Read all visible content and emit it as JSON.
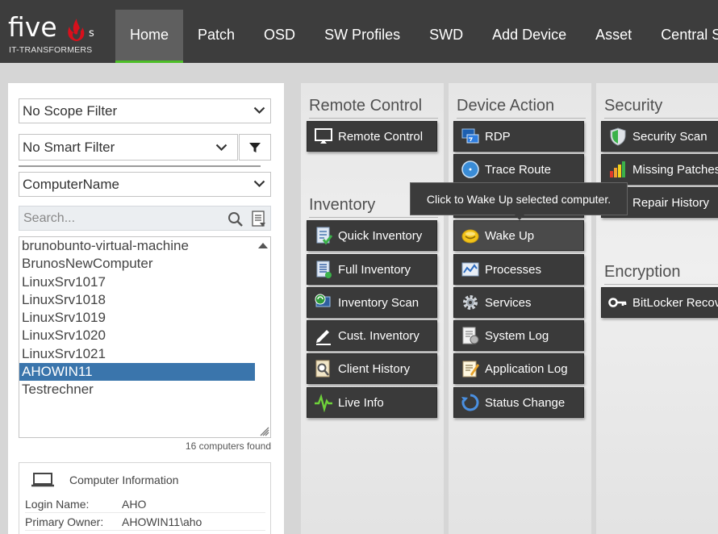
{
  "brand": {
    "word": "five",
    "suffix": "s",
    "subtitle": "IT-TRANSFORMERS"
  },
  "nav": {
    "items": [
      {
        "label": "Home",
        "active": true
      },
      {
        "label": "Patch"
      },
      {
        "label": "OSD"
      },
      {
        "label": "SW Profiles"
      },
      {
        "label": "SWD"
      },
      {
        "label": "Add Device"
      },
      {
        "label": "Asset"
      },
      {
        "label": "Central Sea"
      }
    ]
  },
  "left": {
    "scope_filter": "No Scope Filter",
    "smart_filter": "No Smart Filter",
    "attribute": "ComputerName",
    "search_placeholder": "Search...",
    "computers": [
      "brunobunto-virtual-machine",
      "BrunosNewComputer",
      "LinuxSrv1017",
      "LinuxSrv1018",
      "LinuxSrv1019",
      "LinuxSrv1020",
      "LinuxSrv1021",
      "AHOWIN11",
      "Testrechner"
    ],
    "selected_computer": "AHOWIN11",
    "found_text": "16 computers found",
    "info": {
      "title": "Computer Information",
      "login_label": "Login Name:",
      "login_value": "AHO",
      "owner_label": "Primary Owner:",
      "owner_value": "AHOWIN11\\aho"
    }
  },
  "remote_control": {
    "title": "Remote Control",
    "tiles": [
      "Remote Control"
    ]
  },
  "inventory": {
    "title": "Inventory",
    "tiles": [
      "Quick Inventory",
      "Full Inventory",
      "Inventory Scan",
      "Cust. Inventory",
      "Client History",
      "Live Info"
    ]
  },
  "device_action": {
    "title": "Device Action",
    "tiles": [
      "RDP",
      "Trace Route",
      "",
      "Wake Up",
      "Processes",
      "Services",
      "System Log",
      "Application Log",
      "Status Change"
    ]
  },
  "security": {
    "title": "Security",
    "tiles": [
      "Security Scan",
      "Missing Patches",
      "Repair History"
    ]
  },
  "encryption": {
    "title": "Encryption",
    "tiles": [
      "BitLocker Recove"
    ]
  },
  "tooltip": "Click to Wake Up selected computer.",
  "colors": {
    "accent_green": "#4cbe26",
    "selected_blue": "#3a75ac",
    "tile_dark": "#3a3a3a",
    "topbar": "#3d3d3d"
  }
}
